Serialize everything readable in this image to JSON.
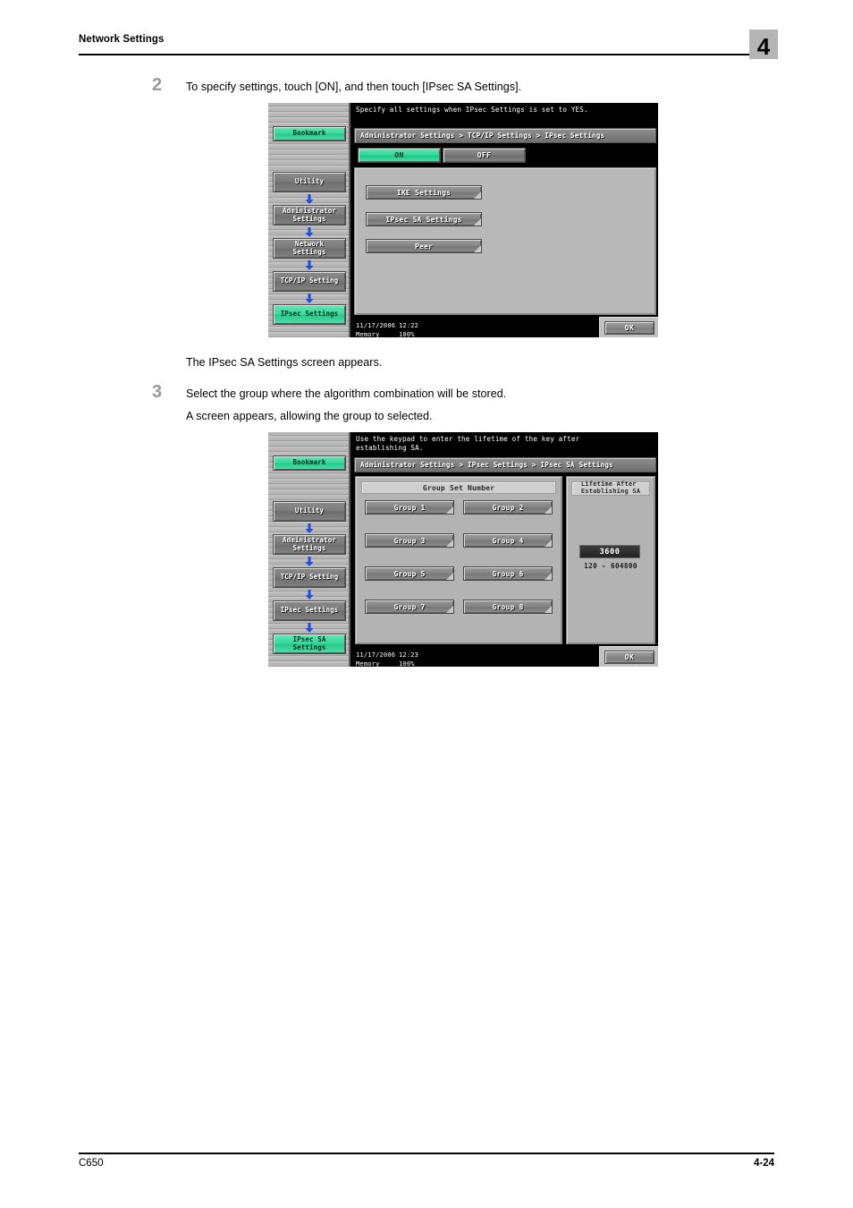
{
  "header": {
    "title": "Network Settings",
    "chapter": "4"
  },
  "footer": {
    "model": "C650",
    "page": "4-24"
  },
  "steps": [
    {
      "number": "2",
      "text": "To specify settings, touch [ON], and then touch [IPsec SA Settings].",
      "result": "The IPsec SA Settings screen appears."
    },
    {
      "number": "3",
      "text": "Select the group where the algorithm combination will be stored.",
      "result": "A screen appears, allowing the group to selected."
    }
  ],
  "panel1": {
    "message": "Specify all settings when IPsec Settings is set to YES.",
    "breadcrumb": "Administrator Settings > TCP/IP Settings > IPsec Settings",
    "nav": {
      "bookmark": "Bookmark",
      "items": [
        {
          "label": "Utility",
          "state": "grey"
        },
        {
          "label": "Administrator\nSettings",
          "state": "grey"
        },
        {
          "label": "Network\nSettings",
          "state": "grey"
        },
        {
          "label": "TCP/IP Setting",
          "state": "grey"
        },
        {
          "label": "IPsec Settings",
          "state": "green"
        }
      ]
    },
    "toggle": {
      "on": "ON",
      "off": "OFF",
      "selected": "ON"
    },
    "buttons": [
      "IKE Settings",
      "IPsec SA Settings",
      "Peer"
    ],
    "status": {
      "date": "11/17/2006",
      "time": "12:22",
      "memory_label": "Memory",
      "memory_value": "100%"
    },
    "ok": "OK"
  },
  "panel2": {
    "message": "Use the keypad to enter the lifetime of the key after\nestablishing SA.",
    "breadcrumb": "Administrator Settings > IPsec Settings > IPsec SA Settings",
    "nav": {
      "bookmark": "Bookmark",
      "items": [
        {
          "label": "Utility",
          "state": "grey"
        },
        {
          "label": "Administrator\nSettings",
          "state": "grey"
        },
        {
          "label": "TCP/IP Setting",
          "state": "grey"
        },
        {
          "label": "IPsec Settings",
          "state": "grey"
        },
        {
          "label": "IPsec SA\nSettings",
          "state": "green"
        }
      ]
    },
    "group_section_title": "Group Set Number",
    "groups": [
      "Group 1",
      "Group 2",
      "Group 3",
      "Group 4",
      "Group 5",
      "Group 6",
      "Group 7",
      "Group 8"
    ],
    "lifetime": {
      "title": "Lifetime After\nEstablishing SA",
      "value": "3600",
      "range": "120 - 604800"
    },
    "status": {
      "date": "11/17/2006",
      "time": "12:23",
      "memory_label": "Memory",
      "memory_value": "100%"
    },
    "ok": "OK"
  },
  "colors": {
    "accent_green": "#34d79c",
    "arrow_blue": "#1d4ed8",
    "chapter_badge": "#b5b5b5",
    "step_number": "#9a9a9a"
  }
}
